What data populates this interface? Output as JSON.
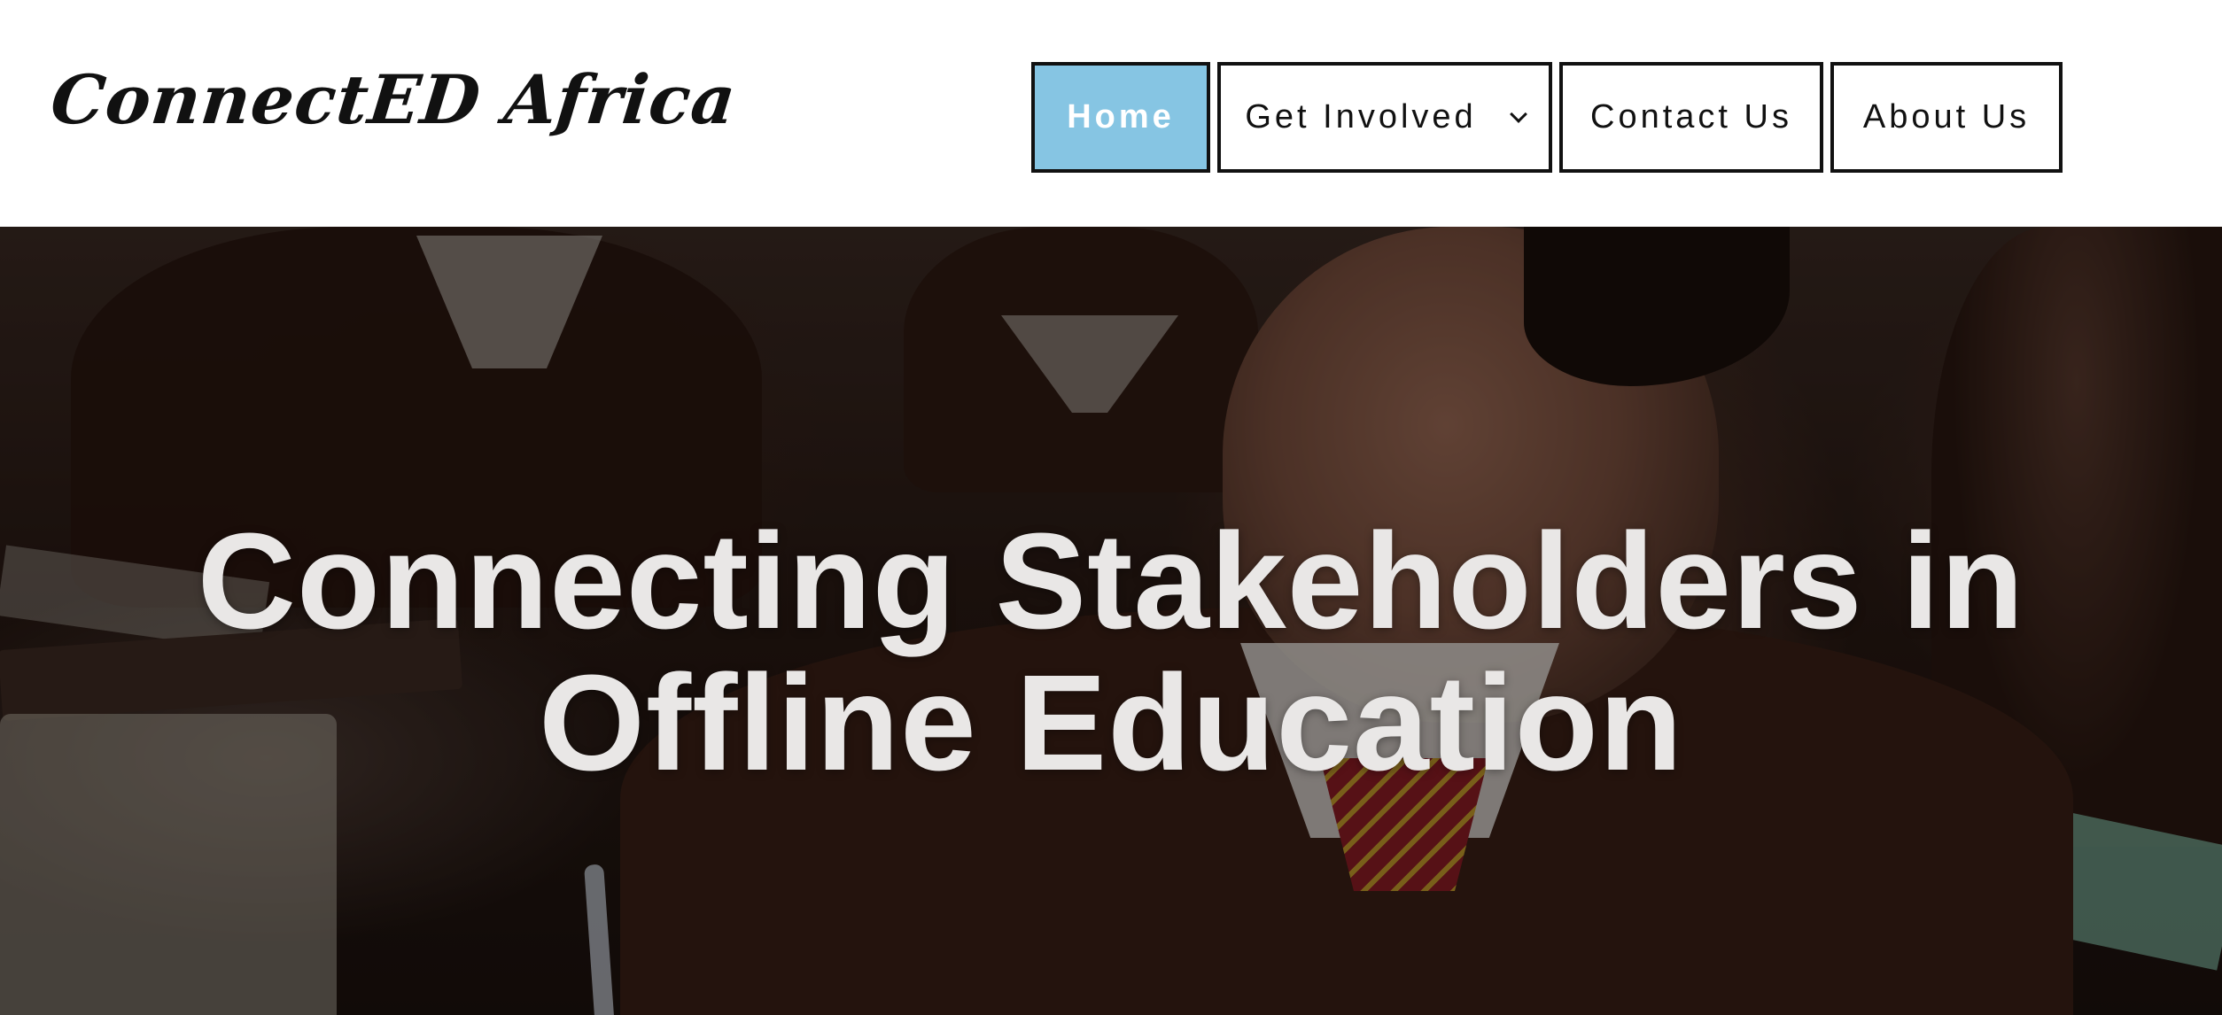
{
  "header": {
    "logo_text": "ConnectED Africa",
    "nav": {
      "home": "Home",
      "get_involved": "Get Involved",
      "contact": "Contact Us",
      "about": "About Us"
    },
    "active_item": "Home",
    "accent_color": "#86c5e3"
  },
  "hero": {
    "title_line1": "Connecting Stakeholders in",
    "title_line2": "Offline Education",
    "image_description_icon": "classroom-photo"
  }
}
